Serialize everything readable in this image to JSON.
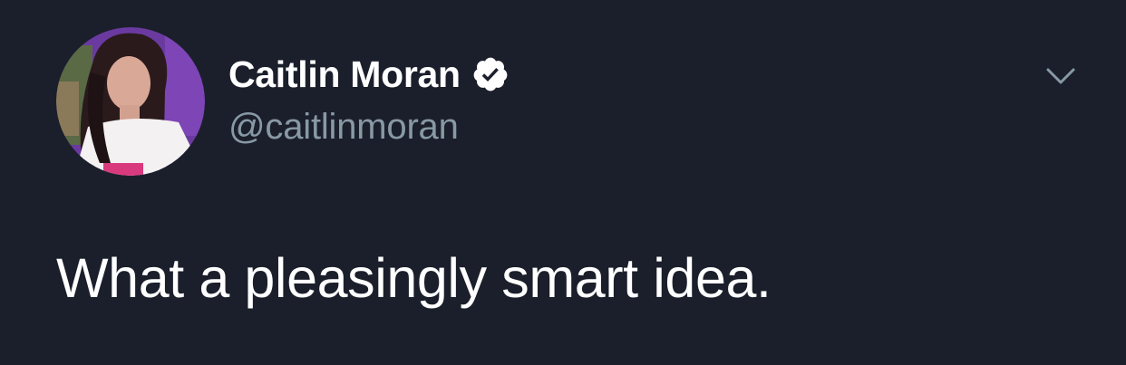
{
  "tweet": {
    "author": {
      "display_name": "Caitlin Moran",
      "handle": "@caitlinmoran",
      "verified": true,
      "avatar_icon": "profile-photo"
    },
    "text": "What a pleasingly smart idea.",
    "menu_icon": "chevron-down-icon"
  },
  "colors": {
    "background": "#1b1f2b",
    "primary_text": "#ffffff",
    "secondary_text": "#8899a6",
    "chevron": "#8899a6"
  }
}
